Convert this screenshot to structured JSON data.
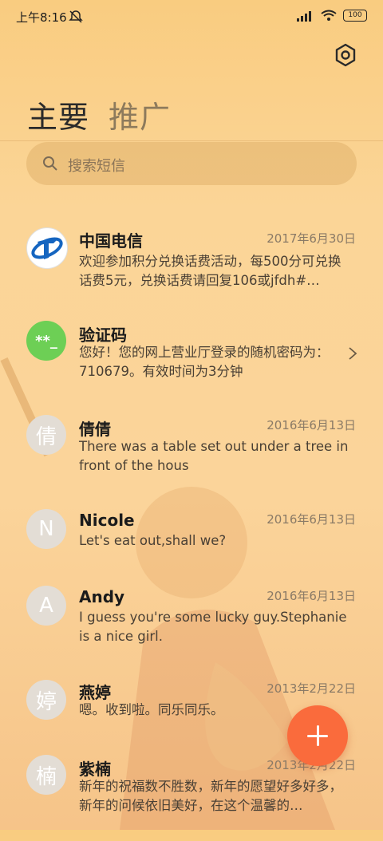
{
  "status_bar": {
    "time": "上午8:16",
    "battery": "100"
  },
  "tabs": [
    {
      "label": "主要"
    },
    {
      "label": "推广"
    }
  ],
  "search": {
    "placeholder": "搜索短信"
  },
  "conversations": [
    {
      "name": "中国电信",
      "date": "2017年6月30日",
      "preview": "欢迎参加积分兑换话费活动，每500分可兑换话费5元，兑换话费请回复106或jfdh#…",
      "avatar": "telecom-logo"
    },
    {
      "name": "验证码",
      "date": "",
      "preview": "您好！您的网上营业厅登录的随机密码为：710679。有效时间为3分钟",
      "avatar_text": "**_"
    },
    {
      "name": "倩倩",
      "date": "2016年6月13日",
      "preview": "There was a table set out under a tree in front of the hous",
      "avatar_text": "倩"
    },
    {
      "name": "Nicole",
      "date": "2016年6月13日",
      "preview": "Let's eat out,shall we?",
      "avatar_text": "N"
    },
    {
      "name": "Andy",
      "date": "2016年6月13日",
      "preview": "I guess you're some lucky guy.Stephanie is a nice girl.",
      "avatar_text": "A"
    },
    {
      "name": "燕婷",
      "date": "2013年2月22日",
      "preview": "嗯。收到啦。同乐同乐。",
      "avatar_text": "婷"
    },
    {
      "name": "紫楠",
      "date": "2013年2月22日",
      "preview": "新年的祝福数不胜数，新年的愿望好多好多，新年的问候依旧美好，在这个温馨的…",
      "avatar_text": "楠"
    }
  ],
  "colors": {
    "accent": "#fa6b3c",
    "verify_avatar": "#6dcf55",
    "telecom_blue": "#1565c0"
  }
}
